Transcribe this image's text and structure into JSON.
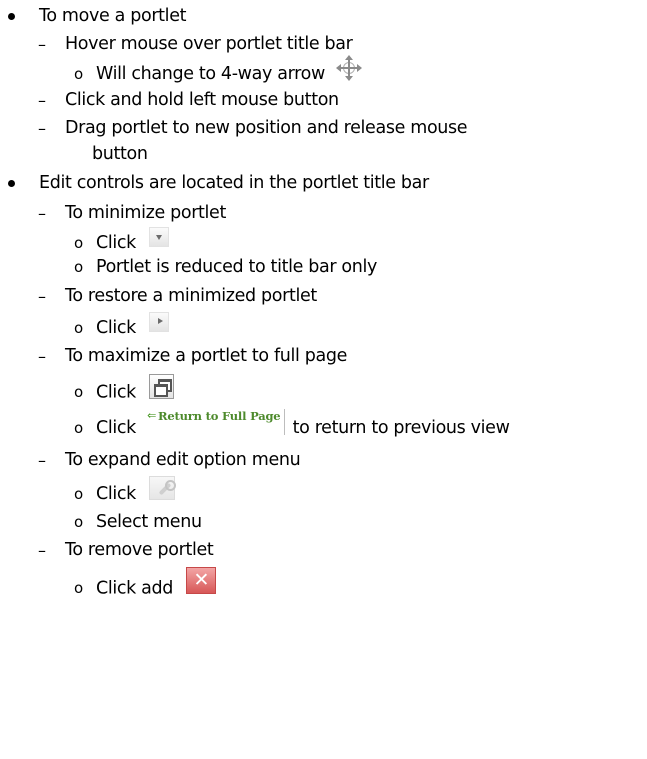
{
  "bullets": {
    "b1": {
      "text": "To move a portlet"
    },
    "b1_1": {
      "text": "Hover mouse over portlet title bar"
    },
    "b1_1_1": {
      "text": "Will change to 4-way arrow"
    },
    "b1_2": {
      "text": "Click and hold left mouse button"
    },
    "b1_3": {
      "text": "Drag portlet to new position and release mouse",
      "cont": "button"
    },
    "b2": {
      "text": "Edit controls are located in the portlet title bar"
    },
    "b2_1": {
      "text": "To minimize portlet"
    },
    "b2_1_1": {
      "text": "Click"
    },
    "b2_1_2": {
      "text": "Portlet is reduced to title bar only"
    },
    "b2_2": {
      "text": "To restore a minimized portlet"
    },
    "b2_2_1": {
      "text": "Click"
    },
    "b2_3": {
      "text": "To maximize a portlet to full page"
    },
    "b2_3_1": {
      "text": "Click"
    },
    "b2_3_2": {
      "pre": "Click",
      "post": "to return to previous view"
    },
    "b2_4": {
      "text": "To expand edit option menu"
    },
    "b2_4_1": {
      "text": "Click"
    },
    "b2_4_2": {
      "text": "Select menu"
    },
    "b2_5": {
      "text": "To remove portlet"
    },
    "b2_5_1": {
      "text": "Click add"
    }
  },
  "markers": {
    "level2": "–",
    "level3": "o"
  },
  "icons": {
    "move": "4-way-arrow-icon",
    "minimize": "triangle-down-icon",
    "restore": "triangle-right-icon",
    "maximize": "maximize-window-icon",
    "return_button": {
      "arrow": "⇐",
      "label": "Return to Full Page"
    },
    "edit": "wrench-icon",
    "remove": {
      "glyph": "✕"
    }
  },
  "colors": {
    "text": "#000000",
    "return_label": "#4d8a2c",
    "remove_icon": "#d75757"
  }
}
